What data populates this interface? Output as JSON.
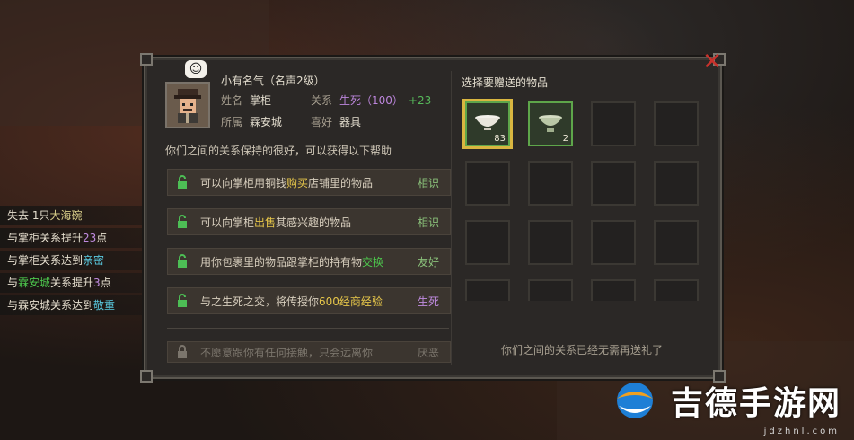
{
  "npc": {
    "fame_text": "小有名气（名声2级）",
    "name_label": "姓名",
    "name": "掌柜",
    "relation_label": "关系",
    "relation_value": "生死（100）",
    "relation_gain": "+23",
    "belong_label": "所属",
    "belong": "霖安城",
    "hobby_label": "喜好",
    "hobby": "器具",
    "speech_icon": "grin-emote-icon"
  },
  "intro_text": "你们之间的关系保持的很好，可以获得以下帮助",
  "perks": [
    {
      "pre": "可以向掌柜用铜钱",
      "hl": "购买",
      "post": "店铺里的物品",
      "level": "相识"
    },
    {
      "pre": "可以向掌柜",
      "hl": "出售",
      "post": "其感兴趣的物品",
      "level": "相识"
    },
    {
      "pre": "用你包裹里的物品跟掌柜的持有物",
      "hl": "交换",
      "post": "",
      "level": "友好"
    },
    {
      "pre": "与之生死之交，将传授你",
      "hl": "600经商经验",
      "post": "",
      "level": "生死"
    },
    {
      "pre": "不愿意跟你有任何接触，只会远离你",
      "hl": "",
      "post": "",
      "level": "厌恶"
    }
  ],
  "gift": {
    "title": "选择要赠送的物品",
    "items": [
      {
        "name": "white-porcelain-bowl-icon",
        "count": "83",
        "color": "#e9e6dc"
      },
      {
        "name": "celadon-bowl-icon",
        "count": "2",
        "color": "#b9c7a6"
      }
    ],
    "no_gift_text": "你们之间的关系已经无需再送礼了"
  },
  "log": {
    "l1_pre": "失去 1只",
    "l1_item": "大海碗",
    "l2_pre": "与掌柜关系提升",
    "l2_num": "23",
    "l2_post": "点",
    "l3_pre": "与掌柜关系达到",
    "l3_state": "亲密",
    "l4_pre": "与",
    "l4_city": "霖安城",
    "l4_mid": "关系提升",
    "l4_num": "3",
    "l4_post": "点",
    "l5_pre": "与霖安城关系达到",
    "l5_state": "敬重"
  },
  "watermark": {
    "name": "吉德手游网",
    "url": "jdzhnl.com"
  },
  "colors": {
    "accent_green": "#4dc84d",
    "accent_yellow": "#e6c64a",
    "accent_purple": "#c08be0",
    "close_red": "#c8322c"
  }
}
